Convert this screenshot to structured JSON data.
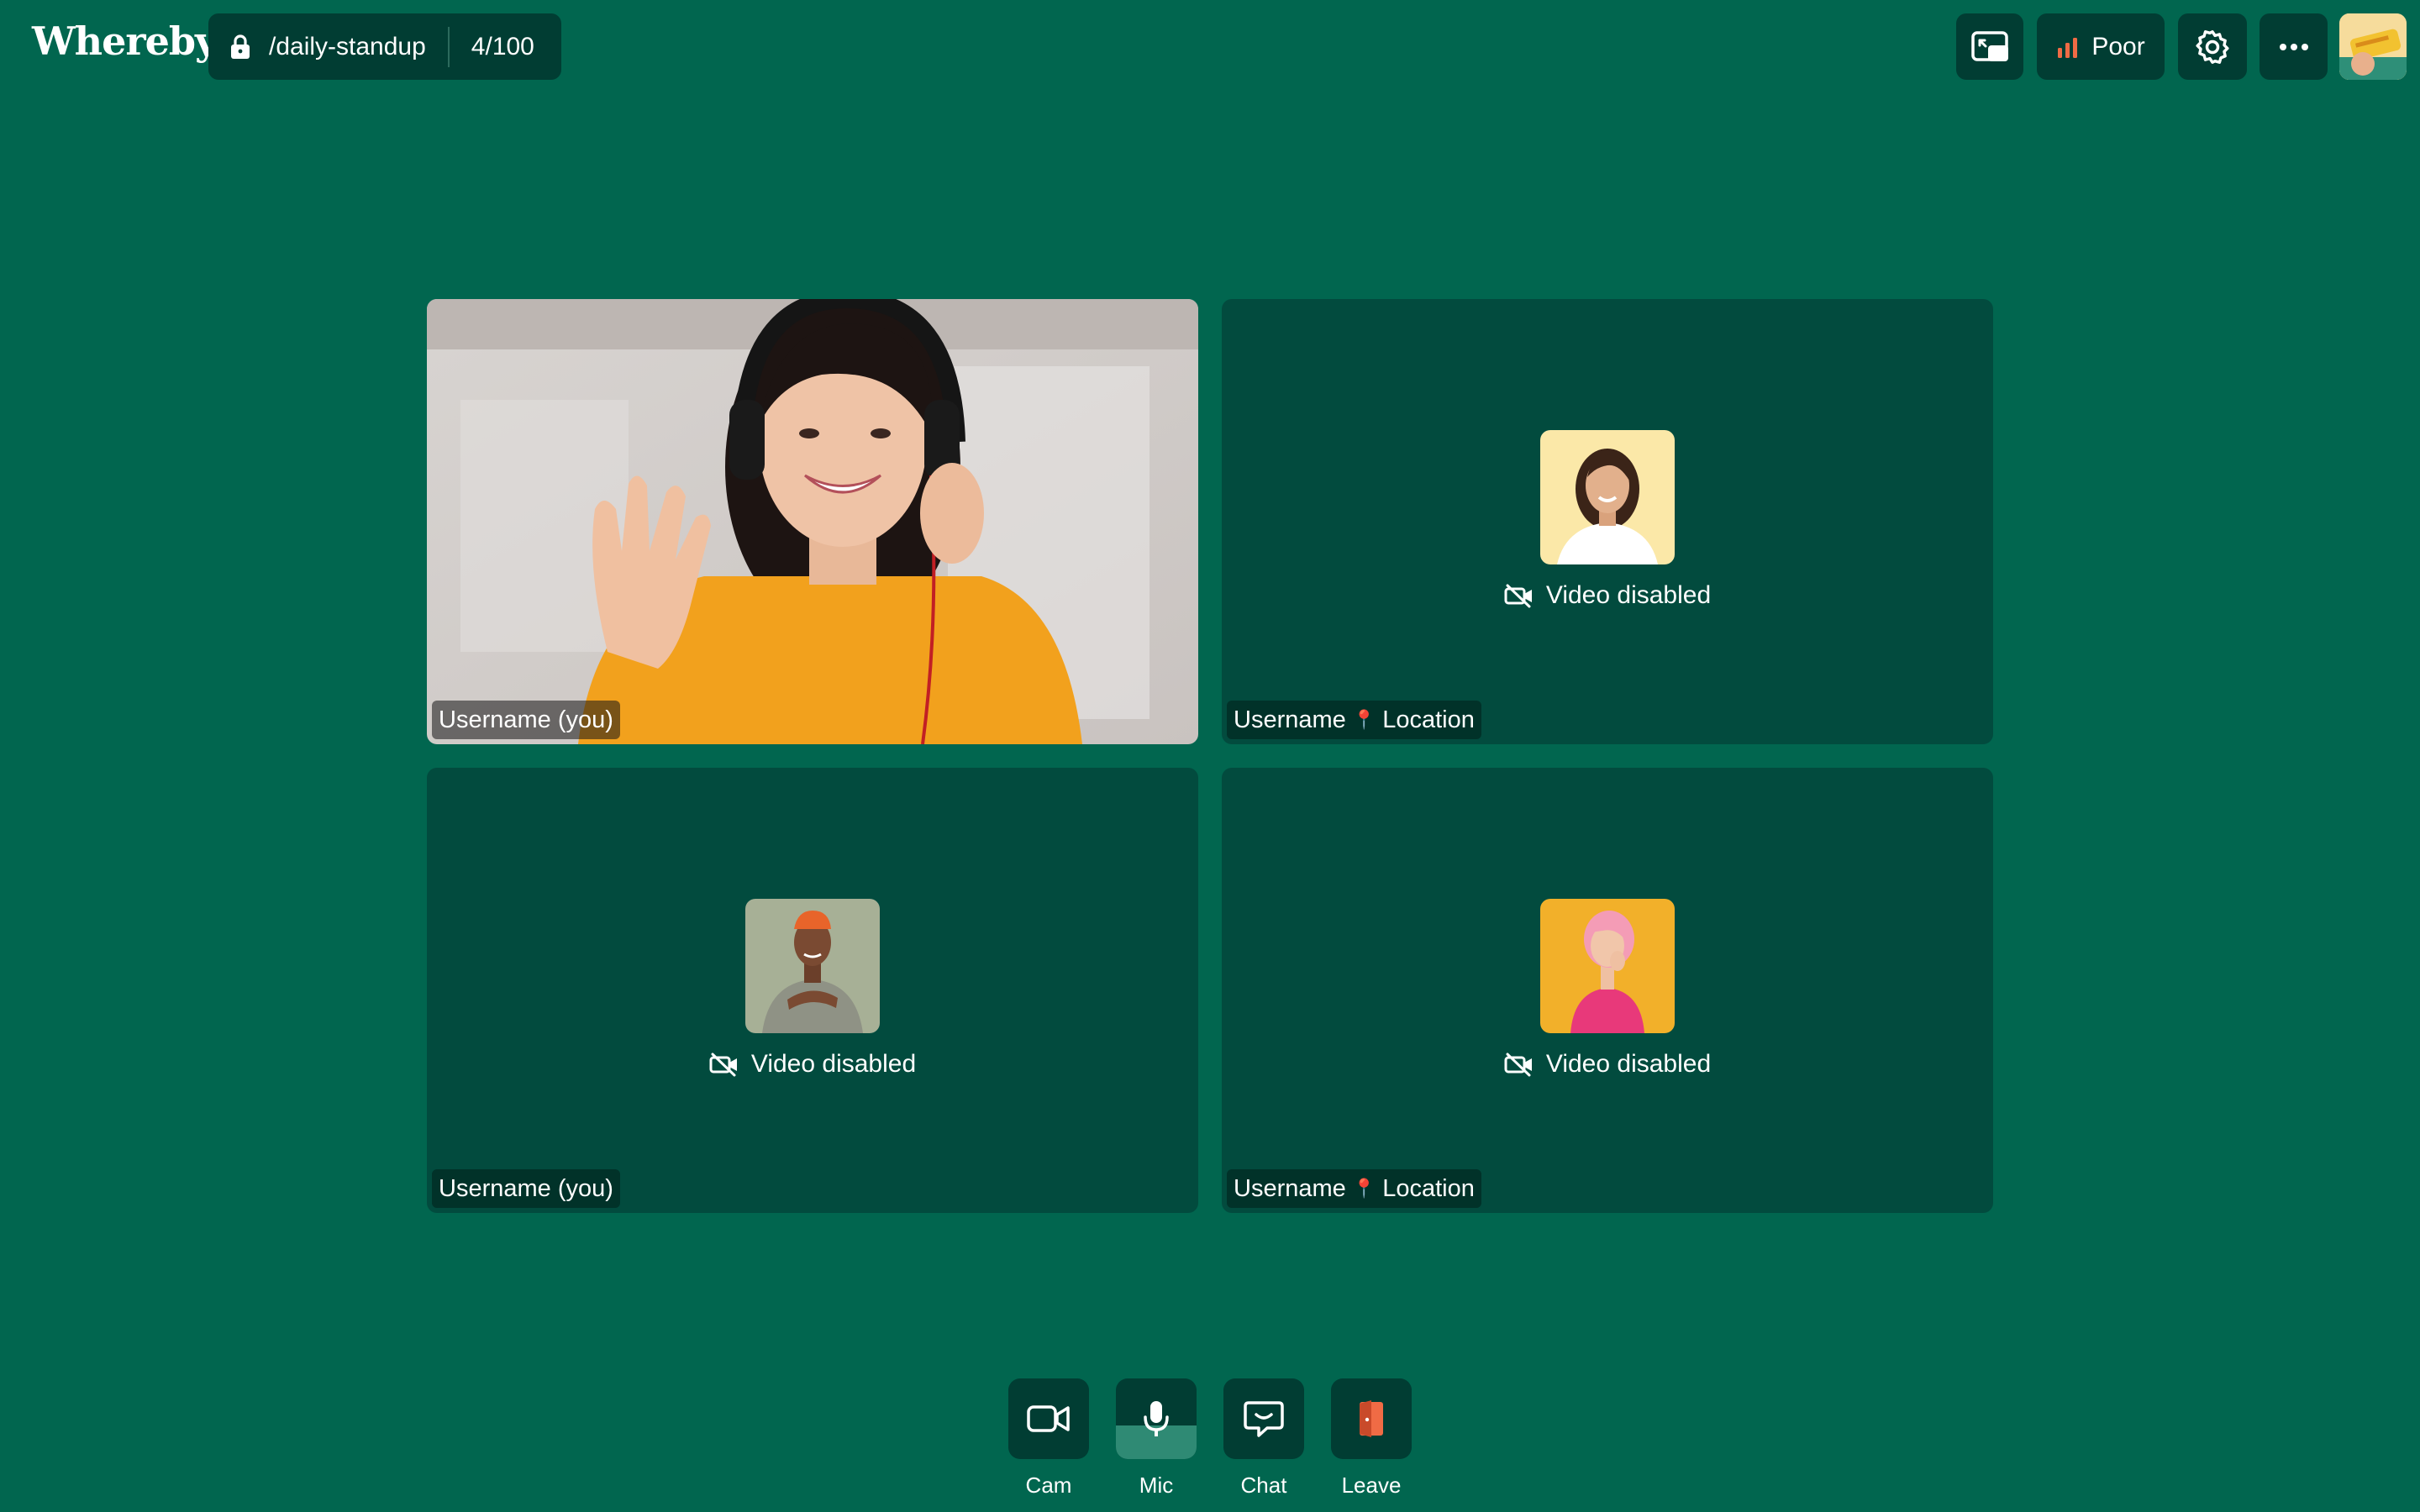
{
  "app": {
    "logo_text": "Whereby"
  },
  "header": {
    "room_name": "/daily-standup",
    "participant_count": "4/100",
    "connection_quality": "Poor",
    "quality_color": "#f06b45"
  },
  "tiles": [
    {
      "name_label": "Username (you)",
      "video_enabled": true
    },
    {
      "name": "Username",
      "location": "Location",
      "status_text": "Video disabled",
      "video_enabled": false
    },
    {
      "name_label": "Username (you)",
      "status_text": "Video disabled",
      "video_enabled": false
    },
    {
      "name": "Username",
      "location": "Location",
      "status_text": "Video disabled",
      "video_enabled": false
    }
  ],
  "controls": {
    "cam_label": "Cam",
    "mic_label": "Mic",
    "mic_level": 0.42,
    "chat_label": "Chat",
    "leave_label": "Leave",
    "leave_color": "#f06b45"
  },
  "colors": {
    "background": "#01664f",
    "panel": "#013d33",
    "tile": "#024b3e"
  }
}
